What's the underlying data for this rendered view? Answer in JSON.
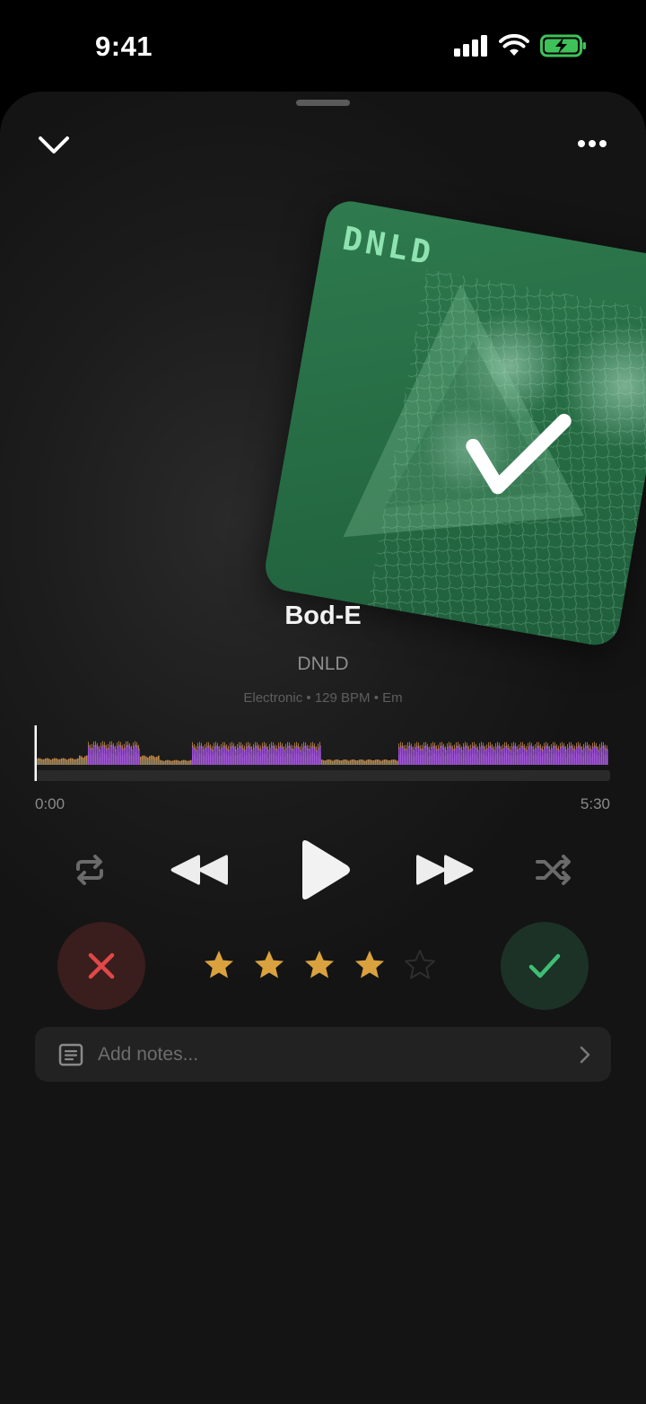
{
  "status_bar": {
    "time": "9:41"
  },
  "album": {
    "logo_text": "DNLD"
  },
  "track": {
    "title": "Bod-E",
    "artist": "DNLD",
    "meta": "Electronic • 129 BPM • Em"
  },
  "playback": {
    "current_time": "0:00",
    "duration": "5:30",
    "progress": 0
  },
  "rating": {
    "value": 4,
    "max": 5
  },
  "notes": {
    "placeholder": "Add notes..."
  },
  "colors": {
    "accent_star": "#d9a23f",
    "waveform_primary": "#9b4fd6",
    "waveform_secondary": "#c4884a",
    "reject": "#e04848",
    "accept": "#3fbf75",
    "album": "#2a7048"
  },
  "icons": {
    "collapse": "chevron-down-icon",
    "more": "more-dots-icon",
    "repeat": "repeat-icon",
    "rewind": "rewind-icon",
    "play": "play-icon",
    "fast_forward": "fast-forward-icon",
    "shuffle": "shuffle-icon",
    "reject": "x-icon",
    "accept": "checkmark-icon",
    "notes": "notes-icon",
    "notes_chevron": "chevron-right-icon"
  }
}
